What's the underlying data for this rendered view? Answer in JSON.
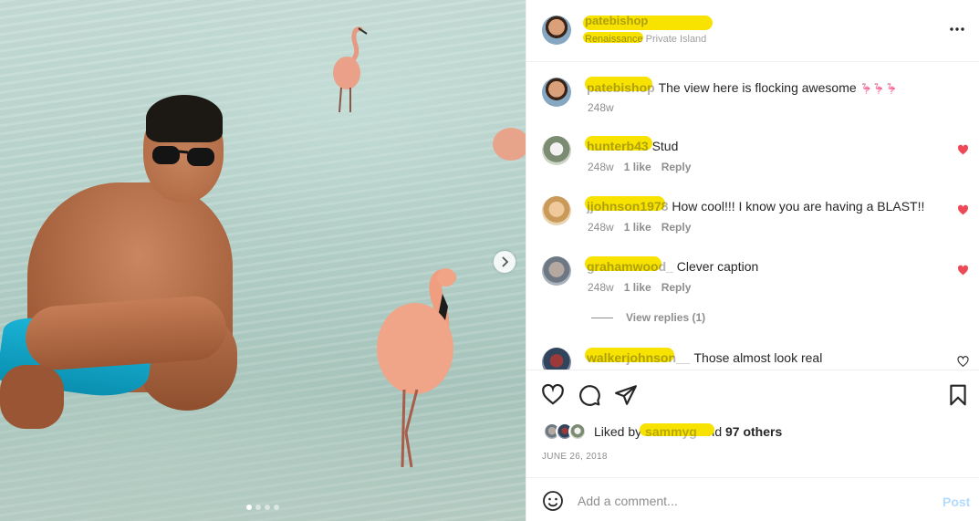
{
  "colors": {
    "accent": "#0095f6",
    "post_disabled": "#b3dbff",
    "like_red": "#ed4956",
    "redaction_yellow": "#f7e200",
    "muted_text": "#8e8e8e"
  },
  "photo": {
    "carousel_dots": 4,
    "active_dot": 1,
    "next_icon": "chevron-right-icon"
  },
  "header": {
    "username": "patebishop",
    "location": "Renaissance Private Island",
    "more_icon": "more-horizontal-icon"
  },
  "caption": {
    "username": "patebishop",
    "text": "The view here is flocking awesome ",
    "emoji": "🦩🦩🦩",
    "time": "248w"
  },
  "comments": [
    {
      "username": "hunterb43",
      "text": "Stud",
      "time": "248w",
      "likes": "1 like",
      "reply": "Reply",
      "liked": true
    },
    {
      "username": "jjohnson1978",
      "text": "How cool!!! I know you are having a BLAST!!",
      "time": "248w",
      "likes": "1 like",
      "reply": "Reply",
      "liked": true
    },
    {
      "username": "grahamwood_",
      "text": "Clever caption",
      "time": "248w",
      "likes": "1 like",
      "reply": "Reply",
      "liked": true
    },
    {
      "username": "walkerjohnson__",
      "text": "Those almost look real",
      "liked": false
    }
  ],
  "view_replies": "View replies (1)",
  "actions": {
    "like_icon": "heart-icon",
    "comment_icon": "comment-icon",
    "share_icon": "send-icon",
    "save_icon": "bookmark-icon"
  },
  "likes": {
    "prefix": "Liked by ",
    "user": "sammyg",
    "middle": " and ",
    "others": "97 others"
  },
  "date": "JUNE 26, 2018",
  "add_comment": {
    "placeholder": "Add a comment...",
    "post_label": "Post",
    "emoji_icon": "smiley-icon"
  }
}
